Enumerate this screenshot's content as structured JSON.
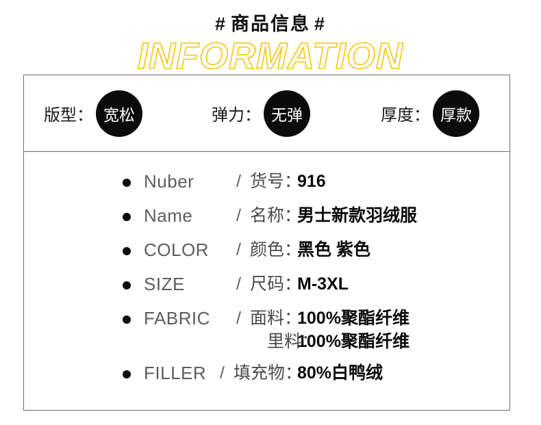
{
  "title": {
    "cn_text": "商品信息",
    "hash_left": "#",
    "hash_right": "#",
    "outline_text": "INFORMATION",
    "outline_color": "#f4c60c",
    "cn_color": "#111111"
  },
  "attributes": [
    {
      "label": "版型：",
      "badge": "宽松"
    },
    {
      "label": "弹力：",
      "badge": "无弹"
    },
    {
      "label": "厚度：",
      "badge": "厚款"
    }
  ],
  "specs": [
    {
      "key": "Nuber",
      "lines": [
        {
          "slash": "/",
          "cn_label": "货号：",
          "value": "916"
        }
      ]
    },
    {
      "key": "Name",
      "lines": [
        {
          "slash": "/",
          "cn_label": "名称：",
          "value": "男士新款羽绒服"
        }
      ]
    },
    {
      "key": "COLOR",
      "lines": [
        {
          "slash": "/",
          "cn_label": "颜色：",
          "value": "黑色 紫色"
        }
      ]
    },
    {
      "key": "SIZE",
      "lines": [
        {
          "slash": "/",
          "cn_label": "尺码：",
          "value": "M-3XL"
        }
      ]
    },
    {
      "key": "FABRIC",
      "lines": [
        {
          "slash": "/",
          "cn_label": "面料：",
          "value": "100%聚酯纤维"
        },
        {
          "slash": "",
          "cn_label": "里料：",
          "value": "100%聚酯纤维"
        }
      ]
    },
    {
      "key": "FILLER",
      "lines": [
        {
          "slash": "/",
          "cn_label": "填充物：",
          "value": "80%白鸭绒"
        }
      ]
    }
  ],
  "colors": {
    "badge_background": "#0b0b0b",
    "badge_text": "#ffffff",
    "frame_border": "#6a6a6a",
    "key_text": "#5d5d5d",
    "value_text": "#0b0b0b",
    "page_background": "#ffffff"
  }
}
